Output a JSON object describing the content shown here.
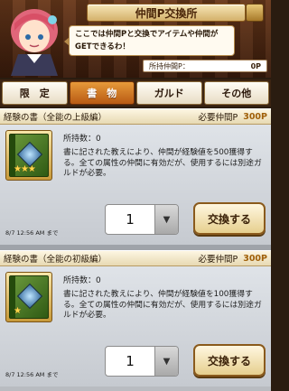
{
  "header": {
    "title": "仲間P交換所",
    "speech_line1": "ここでは仲間Pと交換でアイテムや仲間が",
    "speech_line2": "GETできるわ！",
    "points_label": "所持仲間P：",
    "points_value": "0P"
  },
  "tabs": [
    {
      "label": "限　定",
      "active": false
    },
    {
      "label": "書　物",
      "active": true
    },
    {
      "label": "ガルド",
      "active": false
    },
    {
      "label": "その他",
      "active": false
    }
  ],
  "items": [
    {
      "name": "経験の書（全能の上級編）",
      "cost_label": "必要仲間P",
      "cost_value": "300P",
      "stars": "★★★",
      "owned": "所持数：0",
      "description": "書に記された教えにより、仲間が経験値を500獲得する。全ての属性の仲間に有効だが、使用するには別途ガルドが必要。",
      "expire": "8/7 12:56 AM まで",
      "quantity": "1",
      "button_label": "交換する"
    },
    {
      "name": "経験の書（全能の初級編）",
      "cost_label": "必要仲間P",
      "cost_value": "300P",
      "stars": "★",
      "owned": "所持数：0",
      "description": "書に記された教えにより、仲間が経験値を100獲得する。全ての属性の仲間に有効だが、使用するには別途ガルドが必要。",
      "expire": "8/7 12:56 AM まで",
      "quantity": "1",
      "button_label": "交換する"
    }
  ],
  "colors": {
    "active_tab": "#d27a24",
    "cost_value": "#a0600a",
    "list_bg": "#b9bcc1"
  }
}
